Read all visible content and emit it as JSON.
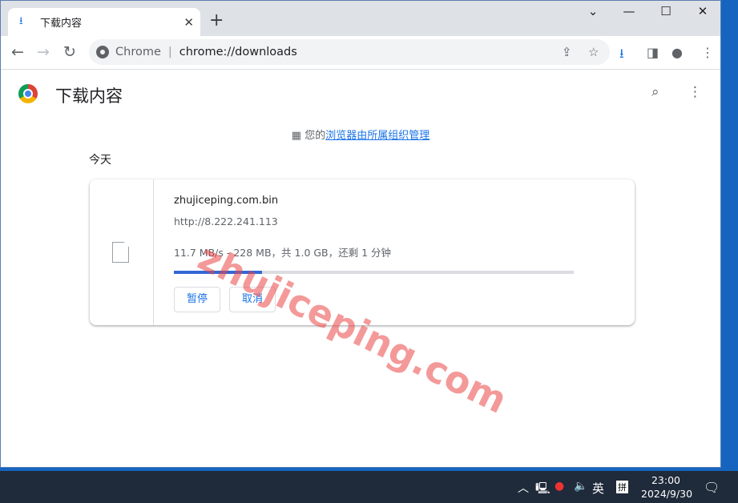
{
  "tab": {
    "title": "下载内容",
    "icon": "download-icon"
  },
  "omnibox": {
    "scheme_label": "Chrome",
    "url": "chrome://downloads"
  },
  "page": {
    "title": "下载内容",
    "managed_prefix": "您的",
    "managed_link": "浏览器由所属组织管理",
    "section": "今天"
  },
  "download": {
    "filename": "zhujiceping.com.bin",
    "url": "http://8.222.241.113",
    "status": "11.7 MB/s - 228 MB，共 1.0 GB，还剩 1 分钟",
    "progress_percent": 22,
    "pause_label": "暂停",
    "cancel_label": "取消"
  },
  "watermark": "zhujiceping.com",
  "taskbar": {
    "ime_lang": "英",
    "ime_mode": "拼",
    "time": "23:00",
    "date": "2024/9/30"
  },
  "colors": {
    "accent": "#1a73e8",
    "progress": "#3367d6",
    "taskbar": "#1f2a3a"
  }
}
